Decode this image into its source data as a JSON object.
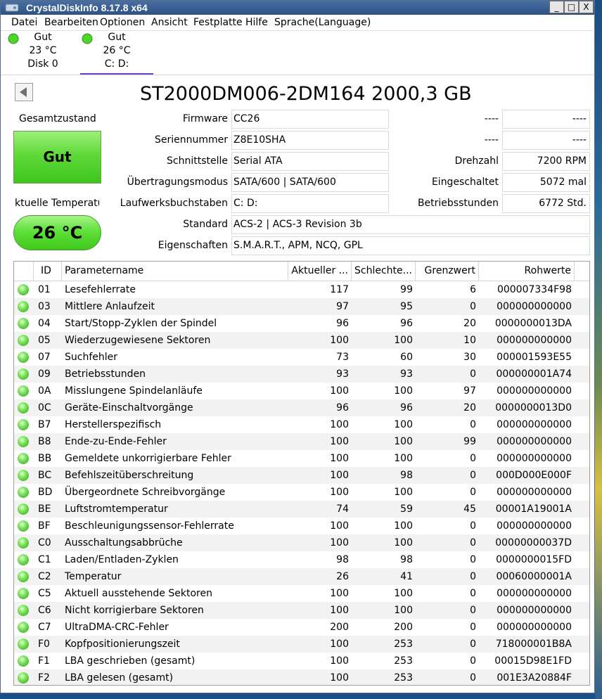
{
  "window": {
    "title": "CrystalDiskInfo 8.17.8 x64",
    "buttons": {
      "minimize": "_",
      "maximize": "□",
      "close": "X"
    }
  },
  "menu": [
    "Datei",
    "Bearbeiten",
    "Optionen",
    "Ansicht",
    "Festplatte",
    "Hilfe",
    "Sprache(Language)"
  ],
  "disks": [
    {
      "status": "Gut",
      "temp": "23 °C",
      "name": "Disk 0"
    },
    {
      "status": "Gut",
      "temp": "26 °C",
      "name": "C: D:"
    }
  ],
  "drive": {
    "title": "ST2000DM006-2DM164 2000,3 GB",
    "health_label": "Gesamtzustand",
    "health_value": "Gut",
    "temp_label": "ktuelle Temperatu",
    "temp_value": "26 °C"
  },
  "info": {
    "firmware": {
      "label": "Firmware",
      "value": "CC26"
    },
    "serial": {
      "label": "Seriennummer",
      "value": "Z8E10SHA"
    },
    "interface": {
      "label": "Schnittstelle",
      "value": "Serial ATA"
    },
    "transfer": {
      "label": "Übertragungsmodus",
      "value": "SATA/600 | SATA/600"
    },
    "letters": {
      "label": "Laufwerksbuchstaben",
      "value": "C: D:"
    },
    "standard": {
      "label": "Standard",
      "value": "ACS-2 | ACS-3 Revision 3b"
    },
    "features": {
      "label": "Eigenschaften",
      "value": "S.M.A.R.T., APM, NCQ, GPL"
    },
    "right_blank1": {
      "label": "----",
      "value": "----"
    },
    "right_blank2": {
      "label": "----",
      "value": "----"
    },
    "rpm": {
      "label": "Drehzahl",
      "value": "7200 RPM"
    },
    "power_count": {
      "label": "Eingeschaltet",
      "value": "5072 mal"
    },
    "power_hours": {
      "label": "Betriebsstunden",
      "value": "6772 Std."
    }
  },
  "table": {
    "headers": {
      "id": "ID",
      "name": "Parametername",
      "current": "Aktueller ...",
      "worst": "Schlechte...",
      "threshold": "Grenzwert",
      "raw": "Rohwerte"
    },
    "rows": [
      {
        "id": "01",
        "name": "Lesefehlerrate",
        "current": "117",
        "worst": "99",
        "threshold": "6",
        "raw": "000007334F98"
      },
      {
        "id": "03",
        "name": "Mittlere Anlaufzeit",
        "current": "97",
        "worst": "95",
        "threshold": "0",
        "raw": "000000000000"
      },
      {
        "id": "04",
        "name": "Start/Stopp-Zyklen der Spindel",
        "current": "96",
        "worst": "96",
        "threshold": "20",
        "raw": "0000000013DA"
      },
      {
        "id": "05",
        "name": "Wiederzugewiesene Sektoren",
        "current": "100",
        "worst": "100",
        "threshold": "10",
        "raw": "000000000000"
      },
      {
        "id": "07",
        "name": "Suchfehler",
        "current": "73",
        "worst": "60",
        "threshold": "30",
        "raw": "000001593E55"
      },
      {
        "id": "09",
        "name": "Betriebsstunden",
        "current": "93",
        "worst": "93",
        "threshold": "0",
        "raw": "000000001A74"
      },
      {
        "id": "0A",
        "name": "Misslungene Spindelanläufe",
        "current": "100",
        "worst": "100",
        "threshold": "97",
        "raw": "000000000000"
      },
      {
        "id": "0C",
        "name": "Geräte-Einschaltvorgänge",
        "current": "96",
        "worst": "96",
        "threshold": "20",
        "raw": "0000000013D0"
      },
      {
        "id": "B7",
        "name": "Herstellerspezifisch",
        "current": "100",
        "worst": "100",
        "threshold": "0",
        "raw": "000000000000"
      },
      {
        "id": "B8",
        "name": "Ende-zu-Ende-Fehler",
        "current": "100",
        "worst": "100",
        "threshold": "99",
        "raw": "000000000000"
      },
      {
        "id": "BB",
        "name": "Gemeldete unkorrigierbare Fehler",
        "current": "100",
        "worst": "100",
        "threshold": "0",
        "raw": "000000000000"
      },
      {
        "id": "BC",
        "name": "Befehlszeitüberschreitung",
        "current": "100",
        "worst": "98",
        "threshold": "0",
        "raw": "000D000E000F"
      },
      {
        "id": "BD",
        "name": "Übergeordnete Schreibvorgänge",
        "current": "100",
        "worst": "100",
        "threshold": "0",
        "raw": "000000000000"
      },
      {
        "id": "BE",
        "name": "Luftstromtemperatur",
        "current": "74",
        "worst": "59",
        "threshold": "45",
        "raw": "00001A19001A"
      },
      {
        "id": "BF",
        "name": "Beschleunigungssensor-Fehlerrate",
        "current": "100",
        "worst": "100",
        "threshold": "0",
        "raw": "000000000000"
      },
      {
        "id": "C0",
        "name": "Ausschaltungsabbrüche",
        "current": "100",
        "worst": "100",
        "threshold": "0",
        "raw": "00000000037D"
      },
      {
        "id": "C1",
        "name": "Laden/Entladen-Zyklen",
        "current": "98",
        "worst": "98",
        "threshold": "0",
        "raw": "0000000015FD"
      },
      {
        "id": "C2",
        "name": "Temperatur",
        "current": "26",
        "worst": "41",
        "threshold": "0",
        "raw": "00060000001A"
      },
      {
        "id": "C5",
        "name": "Aktuell ausstehende Sektoren",
        "current": "100",
        "worst": "100",
        "threshold": "0",
        "raw": "000000000000"
      },
      {
        "id": "C6",
        "name": "Nicht korrigierbare Sektoren",
        "current": "100",
        "worst": "100",
        "threshold": "0",
        "raw": "000000000000"
      },
      {
        "id": "C7",
        "name": "UltraDMA-CRC-Fehler",
        "current": "200",
        "worst": "200",
        "threshold": "0",
        "raw": "000000000000"
      },
      {
        "id": "F0",
        "name": "Kopfpositionierungszeit",
        "current": "100",
        "worst": "253",
        "threshold": "0",
        "raw": "718000001B8A"
      },
      {
        "id": "F1",
        "name": "LBA geschrieben (gesamt)",
        "current": "100",
        "worst": "253",
        "threshold": "0",
        "raw": "00015D98E1FD"
      },
      {
        "id": "F2",
        "name": "LBA gelesen (gesamt)",
        "current": "100",
        "worst": "253",
        "threshold": "0",
        "raw": "001E3A20884F"
      }
    ]
  },
  "colors": {
    "good": "#4fd42a",
    "titlebar": "#2d5182",
    "selected_tab": "#6a3fc2"
  }
}
